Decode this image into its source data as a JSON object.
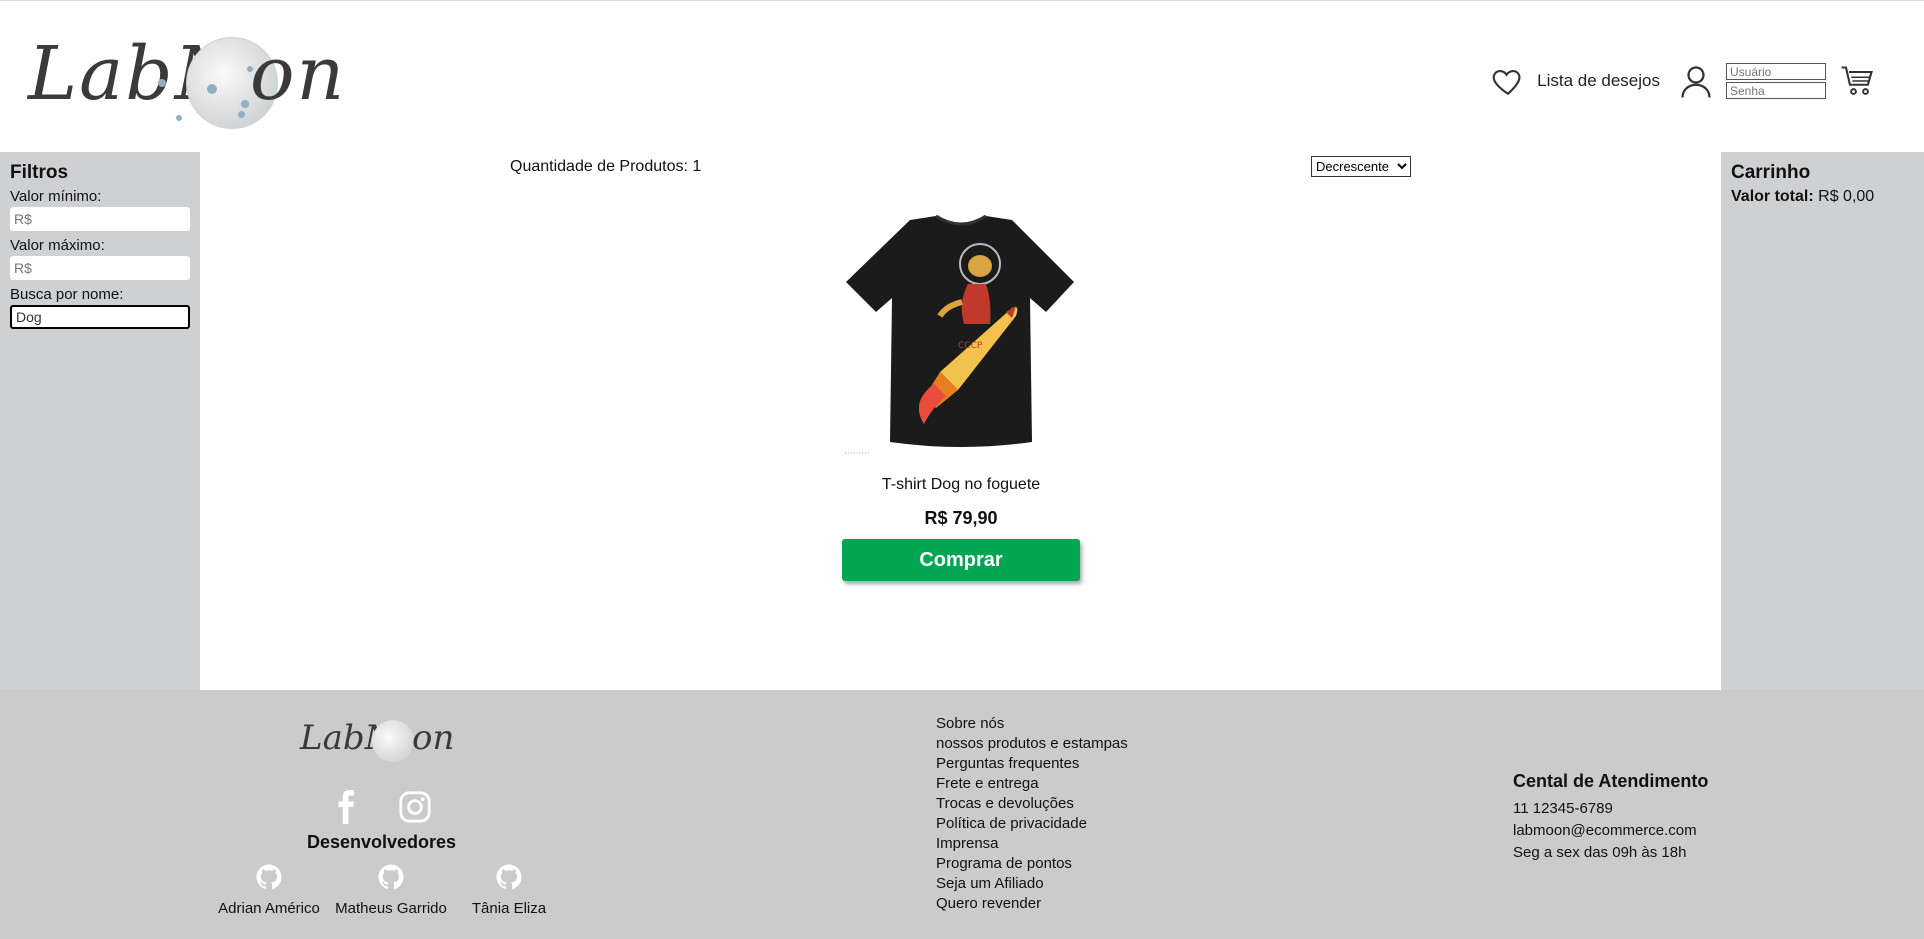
{
  "header": {
    "logo_alt": "LabMoon",
    "wishlist_label": "Lista de desejos",
    "username_placeholder": "Usuário",
    "password_placeholder": "Senha"
  },
  "filters": {
    "title": "Filtros",
    "min_label": "Valor mínimo:",
    "min_placeholder": "R$",
    "max_label": "Valor máximo:",
    "max_placeholder": "R$",
    "name_label": "Busca por nome:",
    "name_value": "Dog"
  },
  "main": {
    "quantity_text": "Quantidade de Produtos: 1",
    "sort_options": [
      "Decrescente"
    ],
    "sort_selected": "Decrescente",
    "products": [
      {
        "name": "T-shirt Dog no foguete",
        "price": "R$ 79,90",
        "buy_label": "Comprar"
      }
    ]
  },
  "cart": {
    "title": "Carrinho",
    "total_label": "Valor total:",
    "total_value": "R$ 0,00"
  },
  "footer": {
    "developers_title": "Desenvolvedores",
    "developers": [
      "Adrian Américo",
      "Matheus Garrido",
      "Tânia Eliza"
    ],
    "links": [
      "Sobre nós",
      "nossos produtos e estampas",
      "Perguntas frequentes",
      "Frete e entrega",
      "Trocas e devoluções",
      "Política de privacidade",
      "Imprensa",
      "Programa de pontos",
      "Seja um Afiliado",
      "Quero revender"
    ],
    "contact": {
      "title": "Cental de Atendimento",
      "phone": "11 12345-6789",
      "email": "labmoon@ecommerce.com",
      "hours": "Seg a sex das 09h às 18h"
    }
  },
  "colors": {
    "sidebar_bg": "#cfd0d2",
    "footer_bg": "#cbcbcb",
    "buy_button": "#00a651"
  }
}
